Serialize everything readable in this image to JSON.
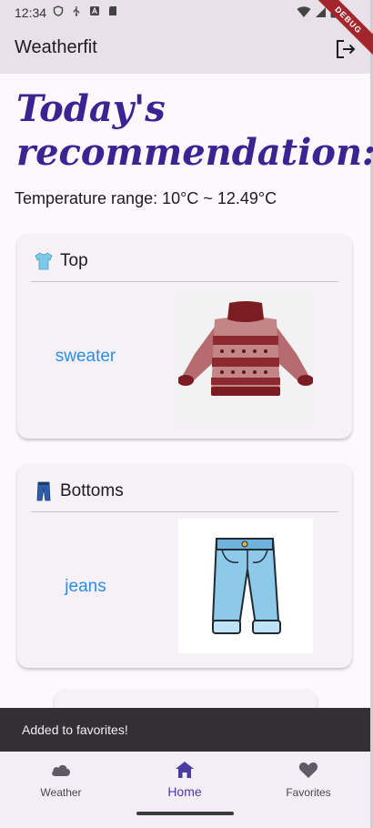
{
  "status_bar": {
    "time": "12:34",
    "left_icons": [
      "shield-icon",
      "usb-icon",
      "a-box-icon",
      "sd-card-icon"
    ],
    "right_icons": [
      "wifi-icon",
      "signal-icon",
      "battery-icon"
    ]
  },
  "debug_banner": "DEBUG",
  "app_bar": {
    "title": "Weatherfit",
    "action_icon": "logout-icon"
  },
  "main": {
    "heading_line1": "Today's",
    "heading_line2": "recommendation:",
    "temperature_text": "Temperature range: 10°C ~ 12.49°C",
    "cards": [
      {
        "category": "Top",
        "icon": "t-shirt-emoji-icon",
        "item": "sweater",
        "image": "sweater-image"
      },
      {
        "category": "Bottoms",
        "icon": "jeans-emoji-icon",
        "item": "jeans",
        "image": "jeans-image"
      }
    ]
  },
  "snackbar": {
    "message": "Added to favorites!"
  },
  "bottom_nav": {
    "items": [
      {
        "label": "Weather",
        "icon": "cloud-icon",
        "selected": false
      },
      {
        "label": "Home",
        "icon": "home-icon",
        "selected": true
      },
      {
        "label": "Favorites",
        "icon": "heart-icon",
        "selected": false
      }
    ]
  },
  "colors": {
    "heading": "#3b2392",
    "item_link": "#2b8ee6",
    "app_bar_bg": "#e8e1ea",
    "nav_selected": "#4a3aa3",
    "snackbar_bg": "#322f35"
  }
}
